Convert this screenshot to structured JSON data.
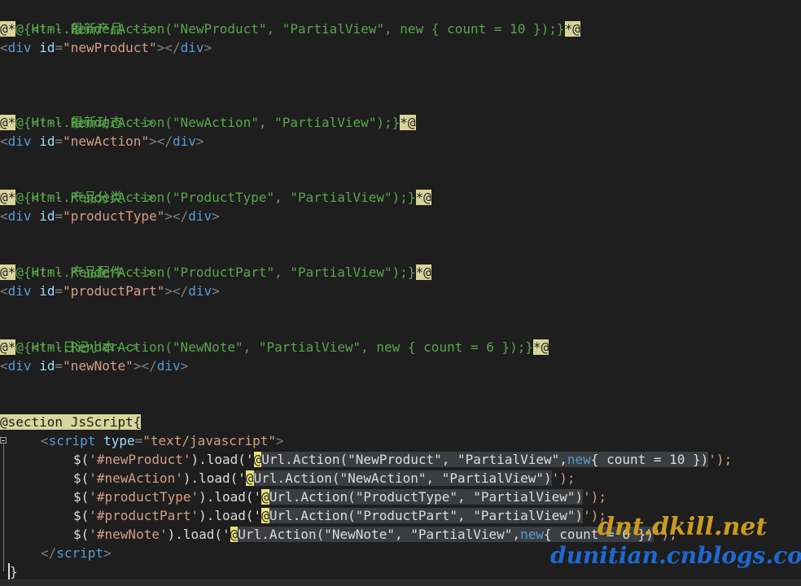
{
  "editor": {
    "c1": "<!-- 最新产品 -->",
    "l2": {
      "open": "@*",
      "code": "@{Html.RenderAction(\"NewProduct\", \"PartialView\", new { count = 10 });}",
      "close": "*@"
    },
    "l3": {
      "id": "newProduct"
    },
    "c4": "<!-- 最新动态 -->",
    "l5": {
      "open": "@*",
      "code": "@{Html.RenderAction(\"NewAction\", \"PartialView\");}",
      "close": "*@"
    },
    "l6": {
      "id": "newAction"
    },
    "c7": "<!-- 产品分类 -->",
    "l8": {
      "open": "@*",
      "code": "@{Html.RenderAction(\"ProductType\", \"PartialView\");}",
      "close": "*@"
    },
    "l9": {
      "id": "productType"
    },
    "c10": "<!-- 产品配件 -->",
    "l11": {
      "open": "@*",
      "code": "@{Html.RenderAction(\"ProductPart\", \"PartialView\");}",
      "close": "*@"
    },
    "l12": {
      "id": "productPart"
    },
    "c13": "<!--日记小本-->",
    "l14": {
      "open": "@*",
      "code": "@{Html.RenderAction(\"NewNote\", \"PartialView\", new { count = 6 });}",
      "close": "*@"
    },
    "l15": {
      "id": "newNote"
    },
    "section": "@section JsScript{",
    "script_open": {
      "tag": "script",
      "attr": "type",
      "value": "\"text/javascript\""
    },
    "js": [
      {
        "sel": "'#newProduct'",
        "at": "@",
        "call": "Url.Action(\"NewProduct\", \"PartialView\",",
        "kw": "new",
        "rest": "{ count = 10 })",
        "end": "');"
      },
      {
        "sel": "'#newAction'",
        "at": "@",
        "call": "Url.Action(\"NewAction\", \"PartialView\")",
        "kw": "",
        "rest": "",
        "end": "');"
      },
      {
        "sel": "'#productType'",
        "at": "@",
        "call": "Url.Action(\"ProductType\", \"PartialView\")",
        "kw": "",
        "rest": "",
        "end": "');"
      },
      {
        "sel": "'#productPart'",
        "at": "@",
        "call": "Url.Action(\"ProductPart\", \"PartialView\")",
        "kw": "",
        "rest": "",
        "end": "');"
      },
      {
        "sel": "'#newNote'",
        "at": "@",
        "call": "Url.Action(\"NewNote\", \"PartialView\",",
        "kw": "new",
        "rest": "{ count = 6 })",
        "end": "');"
      }
    ],
    "script_close": "script",
    "section_close": "}"
  },
  "watermark": {
    "line1": "dnt.dkill.net",
    "line2": "dunitian.cnblogs.com"
  },
  "colors": {
    "background": "#1e1e1e",
    "comment": "#57a64a",
    "string": "#d69d85",
    "keyword": "#569cd6",
    "attribute": "#9cdcfe",
    "razor_marker": "#d9d49a"
  }
}
